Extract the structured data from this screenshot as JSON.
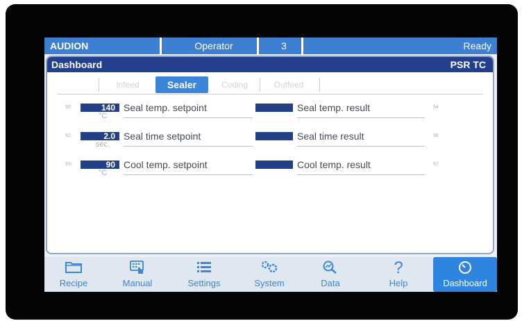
{
  "status": {
    "app": "AUDION",
    "user": "Operator",
    "number": "3",
    "state": "Ready"
  },
  "panel": {
    "title": "Dashboard",
    "model": "PSR TC"
  },
  "tabs": [
    {
      "label": "Infeed",
      "active": false
    },
    {
      "label": "Sealer",
      "active": true
    },
    {
      "label": "Coding",
      "active": false
    },
    {
      "label": "Outfeed",
      "active": false
    }
  ],
  "rows": [
    {
      "tag": "90",
      "value": "140",
      "unit": "°C",
      "label": "Seal temp. setpoint",
      "result_label": "Seal temp. result",
      "result_tag": "94"
    },
    {
      "tag": "92",
      "value": "2.0",
      "unit": "sec.",
      "label": "Seal time setpoint",
      "result_label": "Seal time result",
      "result_tag": "96"
    },
    {
      "tag": "93",
      "value": "90",
      "unit": "°C",
      "label": "Cool temp. setpoint",
      "result_label": "Cool temp. result",
      "result_tag": "97"
    }
  ],
  "nav": [
    {
      "label": "Recipe",
      "icon": "folder-icon"
    },
    {
      "label": "Manual",
      "icon": "keypad-hand-icon"
    },
    {
      "label": "Settings",
      "icon": "list-icon"
    },
    {
      "label": "System",
      "icon": "gears-icon"
    },
    {
      "label": "Data",
      "icon": "magnifier-chart-icon"
    },
    {
      "label": "Help",
      "icon": "question-icon"
    },
    {
      "label": "Dashboard",
      "icon": "gauge-icon",
      "active": true
    }
  ],
  "colors": {
    "accent": "#3b86d8",
    "header": "#24408c",
    "status_bar": "#3d7fd1",
    "value_box": "#22408a"
  }
}
